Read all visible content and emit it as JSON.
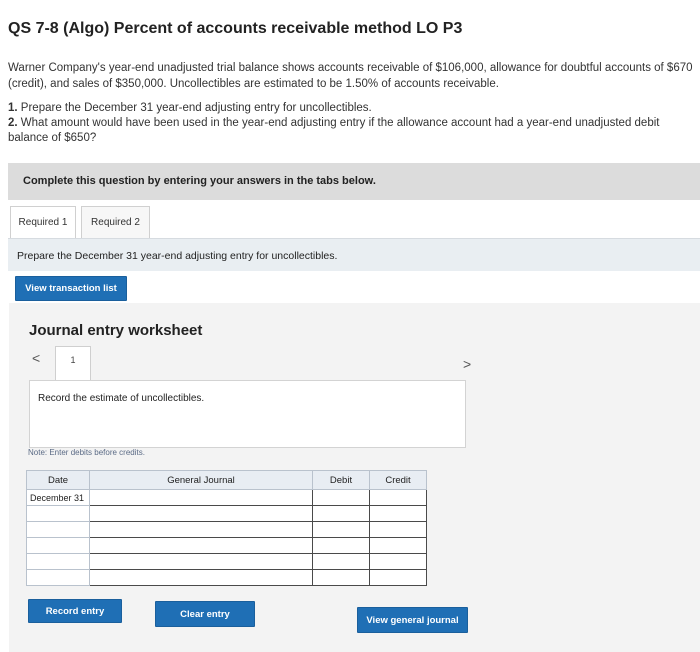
{
  "question": {
    "title": "QS 7-8 (Algo) Percent of accounts receivable method LO P3",
    "problem_text": "Warner Company's year-end unadjusted trial balance shows accounts receivable of $106,000, allowance for doubtful accounts of $670 (credit), and sales of $350,000. Uncollectibles are estimated to be 1.50% of accounts receivable.",
    "requirements": [
      {
        "num": "1.",
        "text": "Prepare the December 31 year-end adjusting entry for uncollectibles."
      },
      {
        "num": "2.",
        "text": "What amount would have been used in the year-end adjusting entry if the allowance account had a year-end unadjusted debit balance of $650?"
      }
    ]
  },
  "instructions": "Complete this question by entering your answers in the tabs below.",
  "tabs": [
    {
      "label": "Required 1"
    },
    {
      "label": "Required 2"
    }
  ],
  "prompt": "Prepare the December 31 year-end adjusting entry for uncollectibles.",
  "buttons": {
    "view_transaction_list": "View transaction list",
    "record_entry": "Record entry",
    "clear_entry": "Clear entry",
    "view_general_journal": "View general journal"
  },
  "worksheet": {
    "title": "Journal entry worksheet",
    "page_number": "1",
    "nav_prev": "<",
    "nav_next": ">",
    "record_instruction": "Record the estimate of uncollectibles.",
    "note": "Note: Enter debits before credits."
  },
  "journal_table": {
    "headers": {
      "date": "Date",
      "general_journal": "General Journal",
      "debit": "Debit",
      "credit": "Credit"
    },
    "rows": [
      {
        "date": "December 31",
        "account": "",
        "debit": "",
        "credit": ""
      },
      {
        "date": "",
        "account": "",
        "debit": "",
        "credit": ""
      },
      {
        "date": "",
        "account": "",
        "debit": "",
        "credit": ""
      },
      {
        "date": "",
        "account": "",
        "debit": "",
        "credit": ""
      },
      {
        "date": "",
        "account": "",
        "debit": "",
        "credit": ""
      },
      {
        "date": "",
        "account": "",
        "debit": "",
        "credit": ""
      }
    ]
  },
  "colors": {
    "button_blue": "#1f6fb5",
    "instruction_bar": "#dcdcdc",
    "worksheet_bg": "#f3f3f3",
    "table_header": "#e8edf3"
  }
}
